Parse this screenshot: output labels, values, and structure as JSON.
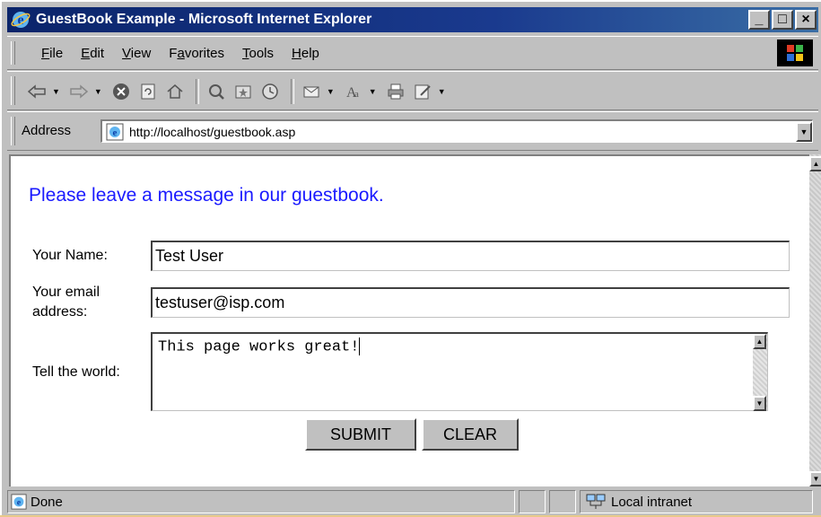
{
  "window": {
    "title": "GuestBook Example - Microsoft Internet Explorer",
    "minimize_glyph": "_",
    "maximize_glyph": "□",
    "close_glyph": "×"
  },
  "menubar": {
    "items": [
      {
        "label": "File",
        "access_key": "F"
      },
      {
        "label": "Edit",
        "access_key": "E"
      },
      {
        "label": "View",
        "access_key": "V"
      },
      {
        "label": "Favorites",
        "access_key": "a"
      },
      {
        "label": "Tools",
        "access_key": "T"
      },
      {
        "label": "Help",
        "access_key": "H"
      }
    ]
  },
  "toolbar": {
    "buttons": [
      "back-icon",
      "forward-icon",
      "stop-icon",
      "refresh-icon",
      "home-icon",
      "search-icon",
      "favorites-icon",
      "history-icon",
      "mail-icon",
      "print-icon",
      "edit-icon"
    ]
  },
  "address": {
    "label": "Address",
    "url": "http://localhost/guestbook.asp"
  },
  "page": {
    "heading": "Please leave a message in our guestbook.",
    "name_label": "Your Name:",
    "name_value": "Test User",
    "email_label_line1": "Your email",
    "email_label_line2": "address:",
    "email_value": "testuser@isp.com",
    "message_label": "Tell the world:",
    "message_value": "This page works great!",
    "submit_label": "SUBMIT",
    "clear_label": "CLEAR"
  },
  "status": {
    "text": "Done",
    "zone": "Local intranet"
  },
  "colors": {
    "title_bar": "#0a246a",
    "heading_text": "#1a1aff",
    "chrome": "#c0c0c0"
  }
}
